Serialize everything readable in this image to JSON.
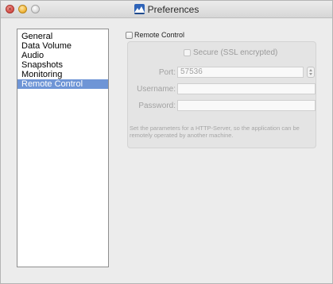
{
  "window": {
    "title": "Preferences",
    "controls": {
      "close": {
        "icon": "close-icon",
        "color": "#d9534c",
        "glyph": "×"
      },
      "minimize": {
        "icon": "minimize-icon",
        "color": "#f2b83e"
      },
      "zoom": {
        "icon": "zoom-icon",
        "color": "#dcdcdc"
      }
    },
    "app_icon": "mountain-app-icon"
  },
  "sidebar": {
    "items": [
      {
        "label": "General",
        "selected": false
      },
      {
        "label": "Data Volume",
        "selected": false
      },
      {
        "label": "Audio",
        "selected": false
      },
      {
        "label": "Snapshots",
        "selected": false
      },
      {
        "label": "Monitoring",
        "selected": false
      },
      {
        "label": "Remote Control",
        "selected": true
      }
    ],
    "selected_color": "#6e95d6"
  },
  "remote_control": {
    "label": "Remote Control",
    "checked": false,
    "secure_label": "Secure (SSL encrypted)",
    "secure_checked": false,
    "port_label": "Port:",
    "port_value": "57536",
    "username_label": "Username:",
    "username_value": "",
    "password_label": "Password:",
    "password_value": "",
    "help_text": "Set the parameters for a HTTP-Server, so the application can be remotely operated by another machine."
  }
}
